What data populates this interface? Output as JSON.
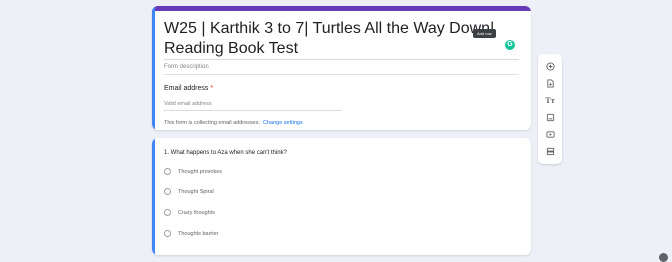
{
  "form": {
    "title": "W25 | Karthik 3 to 7| Turtles All the Way Down| Reading Book Test",
    "description_placeholder": "Form description",
    "tooltip": "Add row",
    "grammarly_letter": "G"
  },
  "email": {
    "label": "Email address",
    "required_mark": "*",
    "placeholder": "Valid email address",
    "collecting_note": "This form is collecting email addresses.",
    "change_settings_link": "Change settings"
  },
  "question": {
    "text": "1. What happens to Aza when she can't think?",
    "options": [
      {
        "label": "Thought provokes"
      },
      {
        "label": "Thought Spiral"
      },
      {
        "label": "Crazy thoughts"
      },
      {
        "label": "Thoughts barrier"
      }
    ]
  },
  "toolbar": {
    "items": [
      "add-question-icon",
      "import-questions-icon",
      "add-title-icon",
      "add-image-icon",
      "add-video-icon",
      "add-section-icon"
    ]
  },
  "colors": {
    "accent": "#673ab7",
    "focus": "#4285f4",
    "background": "#eef0f8",
    "link": "#1a73e8",
    "required": "#d93025"
  }
}
